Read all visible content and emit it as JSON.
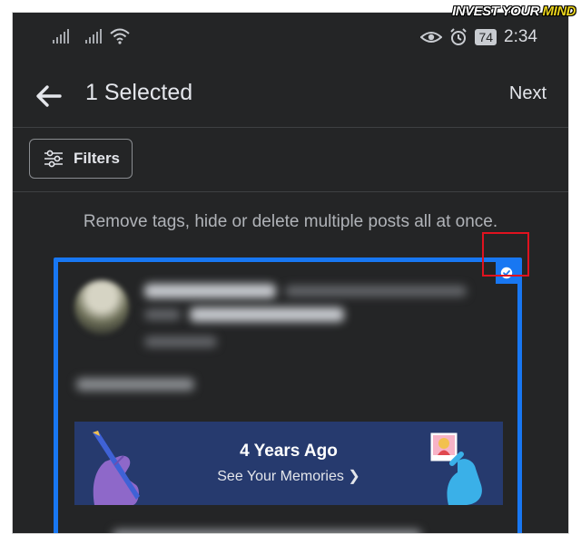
{
  "status_bar": {
    "battery": "74",
    "time": "2:34",
    "icons": [
      "signal-icon",
      "signal-icon",
      "wifi-icon",
      "eye-icon",
      "alarm-icon",
      "battery-icon"
    ]
  },
  "header": {
    "title": "1 Selected",
    "next_label": "Next",
    "back_icon": "arrow-left-icon"
  },
  "filters": {
    "label": "Filters",
    "icon": "sliders-icon"
  },
  "hint": "Remove tags, hide or delete multiple posts all at once.",
  "post": {
    "selected": true,
    "memories": {
      "title": "4 Years Ago",
      "link": "See Your Memories"
    }
  },
  "watermark": {
    "part1": "INVEST YOUR ",
    "part2": "MIND"
  },
  "colors": {
    "background": "#242526",
    "accent": "#1877f2",
    "highlight": "#e0121f",
    "memories_bg": "#263a6e"
  }
}
